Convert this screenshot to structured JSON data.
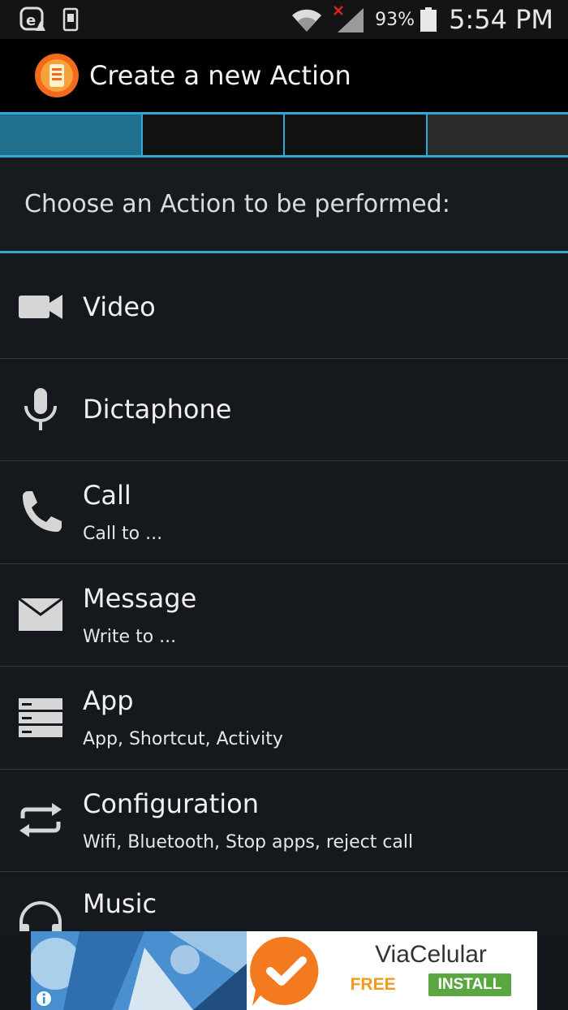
{
  "status_bar": {
    "battery_percent": "93%",
    "time": "5:54 PM"
  },
  "action_bar": {
    "title": "Create a new Action"
  },
  "steps": {
    "count": 4,
    "active_index": 0
  },
  "prompt": "Choose an Action to be performed:",
  "actions": [
    {
      "title": "Video",
      "subtitle": "",
      "icon": "video-camera-icon"
    },
    {
      "title": "Dictaphone",
      "subtitle": "",
      "icon": "microphone-icon"
    },
    {
      "title": "Call",
      "subtitle": "Call to ...",
      "icon": "phone-icon"
    },
    {
      "title": "Message",
      "subtitle": "Write to ...",
      "icon": "envelope-icon"
    },
    {
      "title": "App",
      "subtitle": "App, Shortcut, Activity",
      "icon": "app-list-icon"
    },
    {
      "title": "Configuration",
      "subtitle": "Wifi, Bluetooth, Stop apps, reject call",
      "icon": "repeat-icon"
    },
    {
      "title": "Music",
      "subtitle": "",
      "icon": "headphones-icon"
    }
  ],
  "ad": {
    "app_name": "ViaCelular",
    "price": "FREE",
    "cta": "INSTALL"
  },
  "colors": {
    "accent": "#33a6d4",
    "active_step": "#1f6f8d",
    "ad_free": "#f39a1c",
    "ad_install": "#5aa641"
  }
}
